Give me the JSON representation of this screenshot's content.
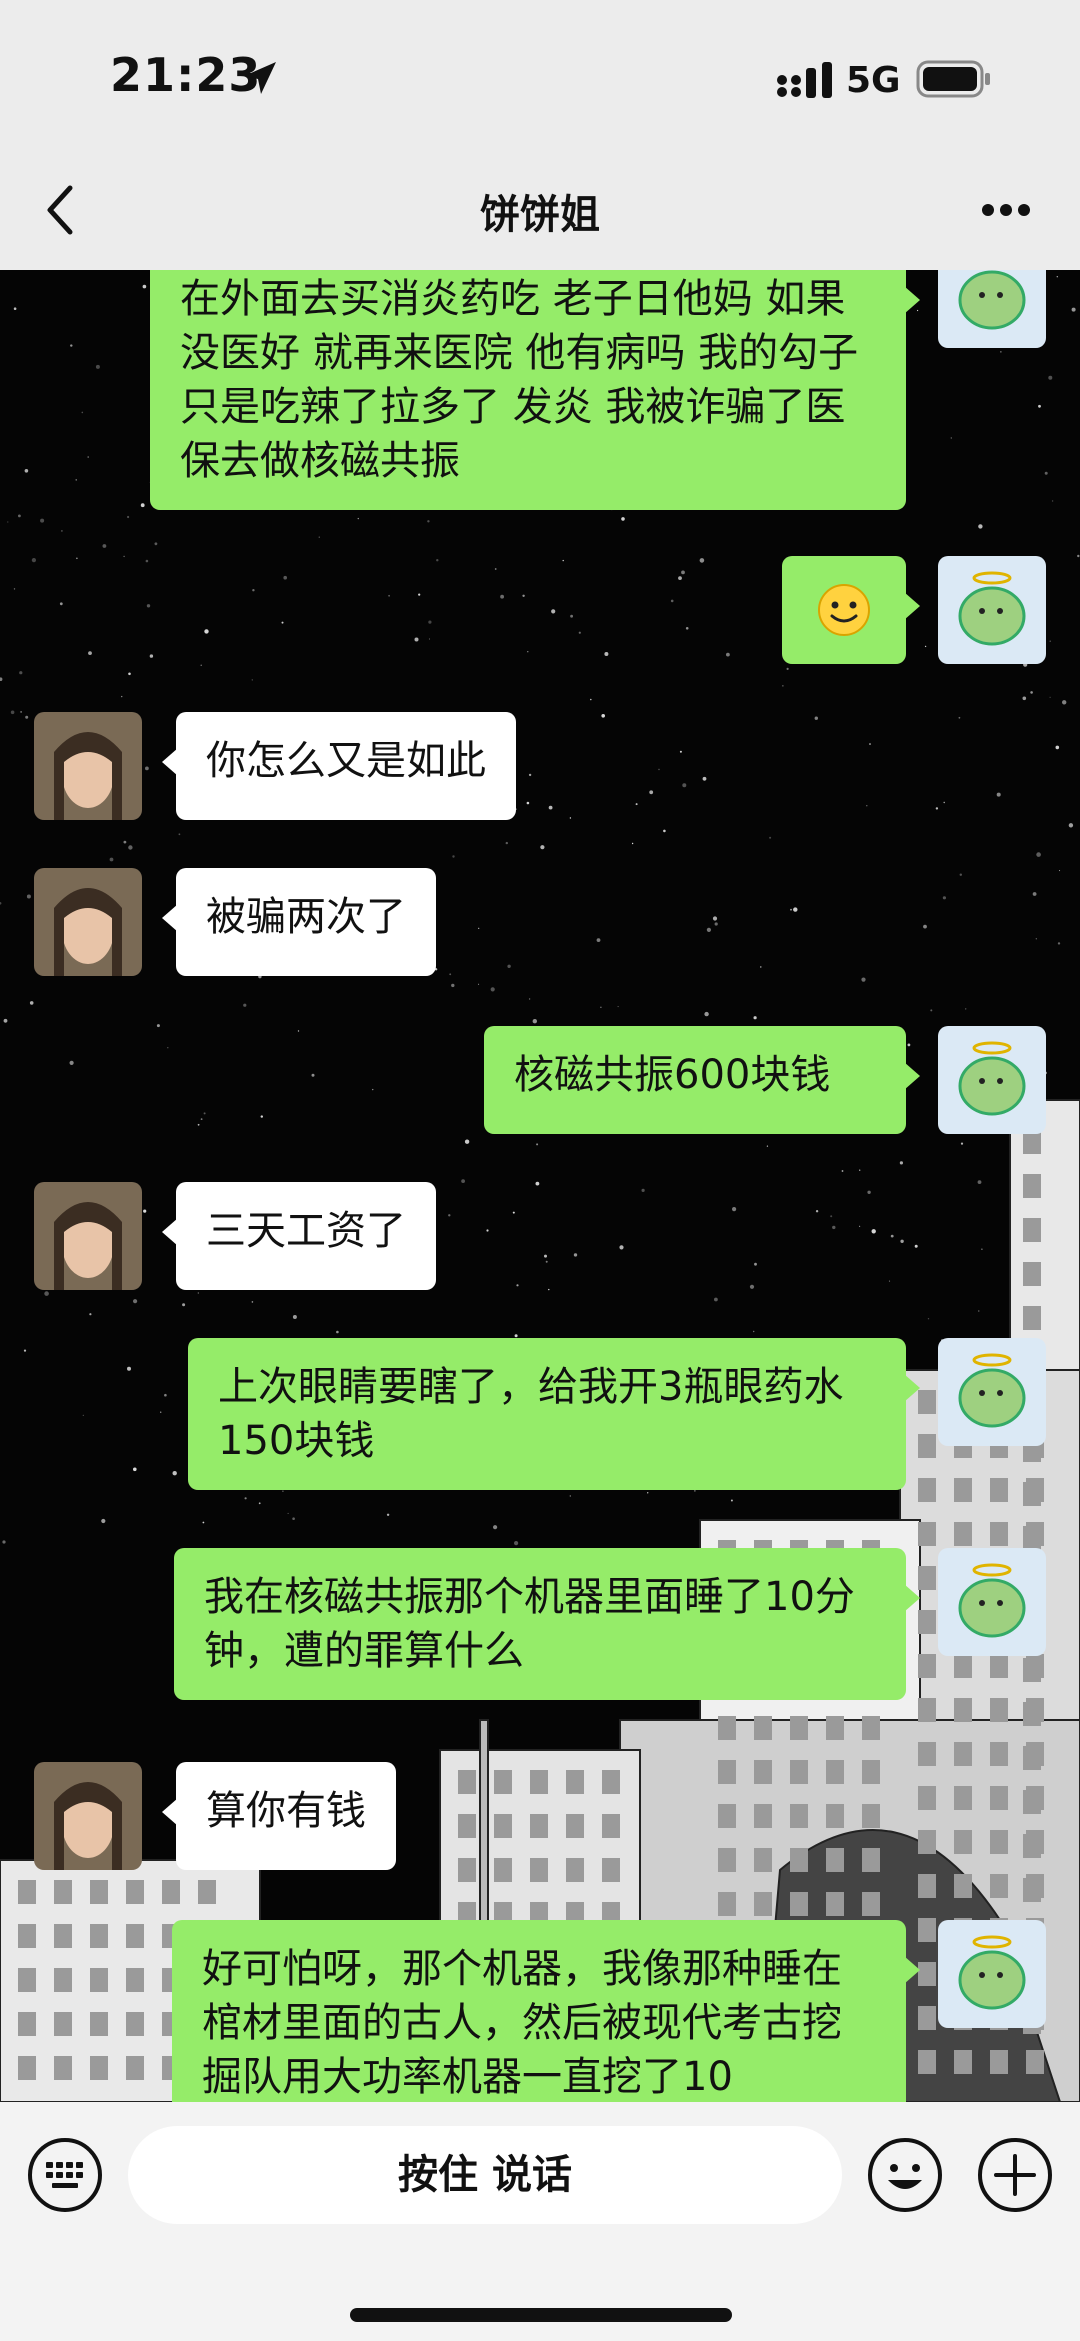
{
  "status_bar": {
    "time": "21:23",
    "network": "5G"
  },
  "nav": {
    "title": "饼饼姐"
  },
  "messages": [
    {
      "side": "sent",
      "text": "在外面去买消炎药吃 老子日他妈 如果没医好 就再来医院 他有病吗 我的勾子只是吃辣了拉多了 发炎 我被诈骗了医保去做核磁共振"
    },
    {
      "side": "sent",
      "emoji": "smile-emoji"
    },
    {
      "side": "recv",
      "text": "你怎么又是如此"
    },
    {
      "side": "recv",
      "text": "被骗两次了"
    },
    {
      "side": "sent",
      "text": "核磁共振600块钱"
    },
    {
      "side": "recv",
      "text": "三天工资了"
    },
    {
      "side": "sent",
      "text": "上次眼睛要瞎了，给我开3瓶眼药水150块钱"
    },
    {
      "side": "sent",
      "text": "我在核磁共振那个机器里面睡了10分钟，遭的罪算什么"
    },
    {
      "side": "recv",
      "text": "算你有钱"
    },
    {
      "side": "sent",
      "text": "好可怕呀，那个机器，我像那种睡在棺材里面的古人，然后被现代考古挖掘队用大功率机器一直挖了10"
    }
  ],
  "input_bar": {
    "hold_to_talk": "按住 说话"
  },
  "icons": {
    "back": "chevron-left-icon",
    "more": "more-dots-icon",
    "keyboard": "keyboard-icon",
    "emoji": "emoji-icon",
    "plus": "plus-icon"
  },
  "colors": {
    "sent_bubble": "#95ec69",
    "recv_bubble": "#ffffff",
    "bar_bg": "#ececec"
  }
}
